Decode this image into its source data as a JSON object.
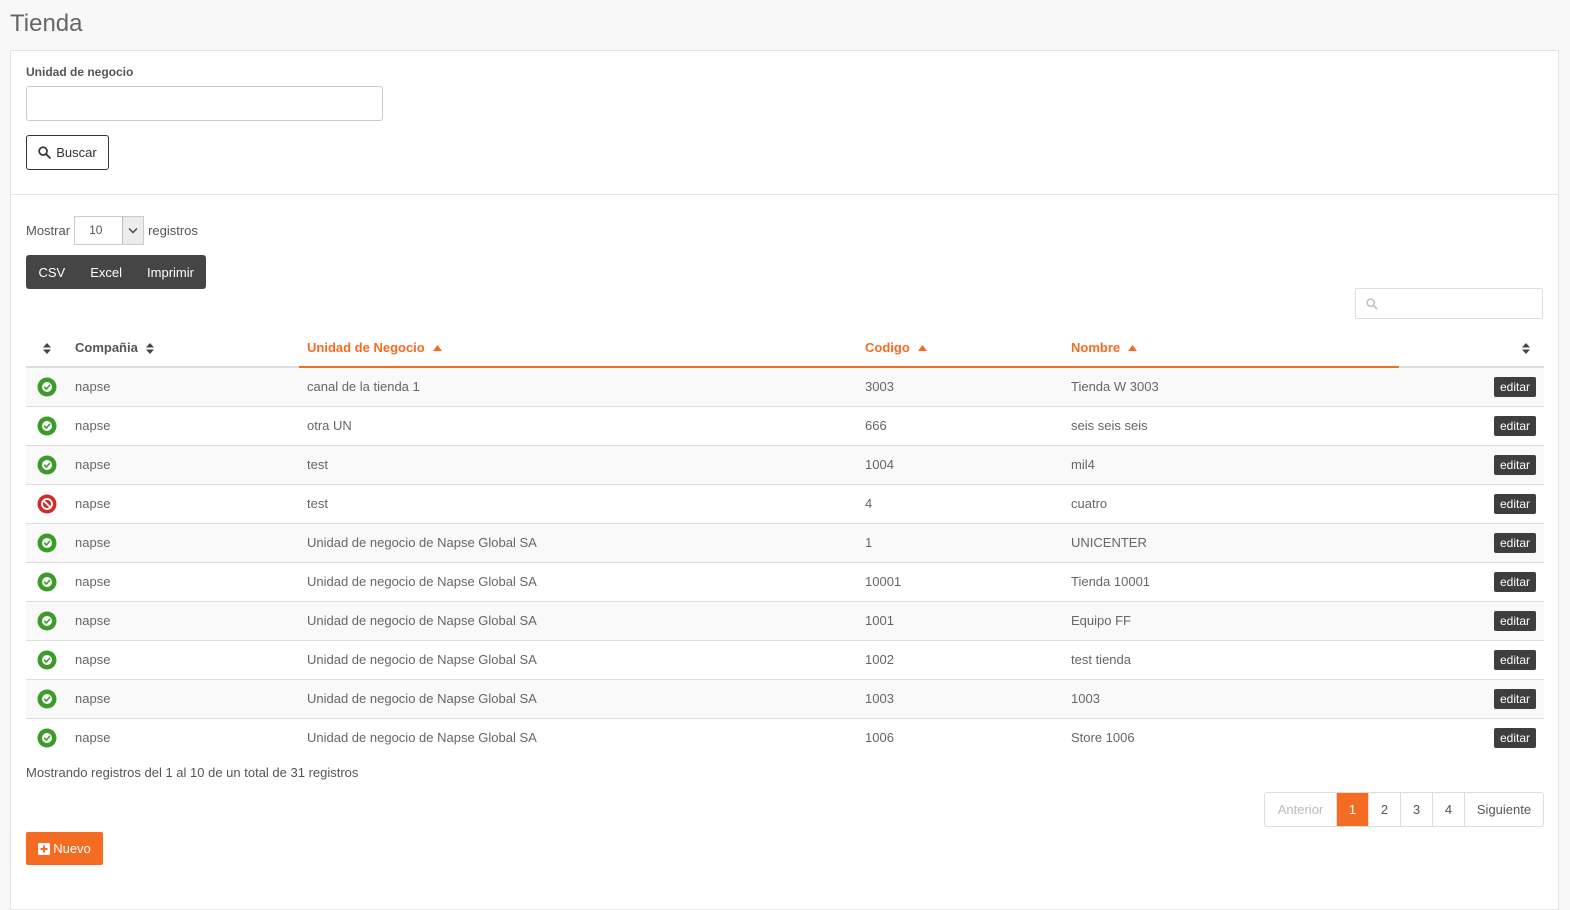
{
  "page": {
    "title": "Tienda"
  },
  "filter": {
    "label": "Unidad de negocio",
    "value": "",
    "search_label": "Buscar"
  },
  "length": {
    "prefix": "Mostrar",
    "value": "10",
    "suffix": "registros"
  },
  "export_buttons": [
    "CSV",
    "Excel",
    "Imprimir"
  ],
  "table": {
    "columns": [
      "",
      "Compañia",
      "Unidad de Negocio",
      "Codigo",
      "Nombre",
      ""
    ],
    "edit_label": "editar",
    "rows": [
      {
        "status": "active",
        "company": "napse",
        "unit": "canal de la tienda 1",
        "code": "3003",
        "name": "Tienda W 3003"
      },
      {
        "status": "active",
        "company": "napse",
        "unit": "otra UN",
        "code": "666",
        "name": "seis seis seis"
      },
      {
        "status": "active",
        "company": "napse",
        "unit": "test",
        "code": "1004",
        "name": "mil4"
      },
      {
        "status": "inactive",
        "company": "napse",
        "unit": "test",
        "code": "4",
        "name": "cuatro"
      },
      {
        "status": "active",
        "company": "napse",
        "unit": "Unidad de negocio de Napse Global SA",
        "code": "1",
        "name": "UNICENTER"
      },
      {
        "status": "active",
        "company": "napse",
        "unit": "Unidad de negocio de Napse Global SA",
        "code": "10001",
        "name": "Tienda 10001"
      },
      {
        "status": "active",
        "company": "napse",
        "unit": "Unidad de negocio de Napse Global SA",
        "code": "1001",
        "name": "Equipo FF"
      },
      {
        "status": "active",
        "company": "napse",
        "unit": "Unidad de negocio de Napse Global SA",
        "code": "1002",
        "name": "test tienda"
      },
      {
        "status": "active",
        "company": "napse",
        "unit": "Unidad de negocio de Napse Global SA",
        "code": "1003",
        "name": "1003"
      },
      {
        "status": "active",
        "company": "napse",
        "unit": "Unidad de negocio de Napse Global SA",
        "code": "1006",
        "name": "Store 1006"
      }
    ]
  },
  "info": "Mostrando registros del 1 al 10 de un total de 31 registros",
  "pagination": {
    "prev": "Anterior",
    "pages": [
      "1",
      "2",
      "3",
      "4"
    ],
    "current": "1",
    "next": "Siguiente"
  },
  "new_button": "Nuevo",
  "colors": {
    "accent": "#f36c21",
    "active": "#3d9b2a",
    "inactive": "#c9302c",
    "dark_button": "#454545"
  }
}
